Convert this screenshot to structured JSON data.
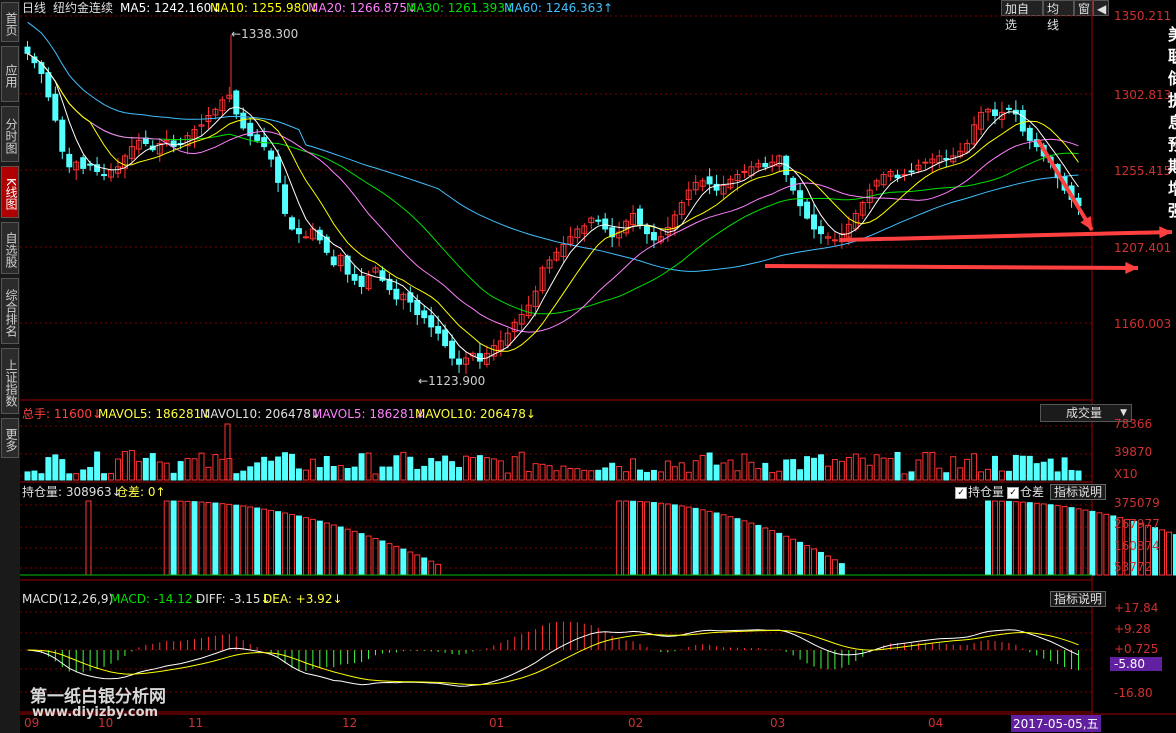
{
  "sidebar": {
    "tabs": [
      {
        "label": "首页"
      },
      {
        "label": "应用"
      },
      {
        "label": "分时图"
      },
      {
        "label": "K线图"
      },
      {
        "label": "自选股"
      },
      {
        "label": "综合排名"
      },
      {
        "label": "上证指数"
      },
      {
        "label": "更多"
      }
    ]
  },
  "header": {
    "period": "日线",
    "instrument": "纽约金连续",
    "ma5": "MA5: 1242.160↓",
    "ma10": "MA10: 1255.980↓",
    "ma20": "MA20: 1266.875↓",
    "ma30": "MA30: 1261.393↓",
    "ma60": "MA60: 1246.363↑",
    "buttons": [
      "加自选",
      "均线",
      "窗"
    ]
  },
  "colors": {
    "up": "#ff3232",
    "down": "#54ffff",
    "ma5": "#ffffff",
    "ma10": "#ffff00",
    "ma20": "#ff80ff",
    "ma30": "#00e000",
    "ma60": "#40c0ff",
    "grid": "#800000",
    "arrow": "#ff4040"
  },
  "price_axis": [
    "1350.211",
    "1302.813",
    "1255.415",
    "1207.401",
    "1160.003"
  ],
  "annotations": {
    "high": "1338.300",
    "low": "1123.900"
  },
  "right_edge_chars": [
    "美",
    "联",
    "储",
    "提",
    "息",
    "预",
    "期",
    "增",
    "强"
  ],
  "volume_panel": {
    "label": "总手: 11600↓",
    "mavol5a": "MAVOL5: 186281↓",
    "mavol10a": "MAVOL10: 206478↓",
    "mavol5b": "MAVOL5: 186281↓",
    "mavol10b": "MAVOL10: 206478↓",
    "selector": "成交量",
    "axis": [
      "78366",
      "39870",
      "X10"
    ]
  },
  "oi_panel": {
    "label": "持仓量: 308963↓",
    "diff": "仓差: 0↑",
    "check_oi": "持仓量",
    "check_diff": "仓差",
    "help": "指标说明",
    "axis": [
      "375079",
      "267977",
      "160874",
      "53772"
    ]
  },
  "macd_panel": {
    "label": "MACD(12,26,9)",
    "macd": "MACD: -14.12↓",
    "diff": "DIFF: -3.15↓",
    "dea": "DEA: +3.92↓",
    "help": "指标说明",
    "axis": [
      "+17.84",
      "+9.28",
      "+0.725",
      "-5.80",
      "-16.80"
    ]
  },
  "x_axis": [
    "09",
    "10",
    "11",
    "12",
    "01",
    "02",
    "03",
    "04"
  ],
  "cursor_date": "2017-05-05,五",
  "watermark": {
    "line1": "第一纸白银分析网",
    "line2": "www.diyizby.com"
  },
  "chart_data": {
    "type": "candlestick",
    "title": "纽约金连续 日线",
    "ylim": [
      1105,
      1352
    ],
    "closes": [
      1328,
      1322,
      1315,
      1300,
      1285,
      1265,
      1255,
      1258,
      1254,
      1256,
      1252,
      1250,
      1253,
      1255,
      1262,
      1268,
      1272,
      1270,
      1266,
      1270,
      1272,
      1268,
      1270,
      1275,
      1279,
      1282,
      1288,
      1292,
      1298,
      1301,
      1289,
      1280,
      1275,
      1272,
      1268,
      1260,
      1245,
      1225,
      1215,
      1212,
      1210,
      1215,
      1208,
      1200,
      1192,
      1198,
      1186,
      1182,
      1178,
      1185,
      1190,
      1182,
      1176,
      1170,
      1173,
      1168,
      1160,
      1158,
      1152,
      1148,
      1140,
      1132,
      1128,
      1132,
      1135,
      1130,
      1135,
      1140,
      1143,
      1148,
      1155,
      1160,
      1166,
      1175,
      1190,
      1195,
      1200,
      1205,
      1210,
      1215,
      1217,
      1222,
      1220,
      1215,
      1210,
      1213,
      1220,
      1225,
      1218,
      1212,
      1208,
      1210,
      1216,
      1224,
      1232,
      1240,
      1245,
      1246,
      1244,
      1240,
      1243,
      1247,
      1250,
      1252,
      1255,
      1257,
      1255,
      1258,
      1262,
      1250,
      1240,
      1230,
      1222,
      1215,
      1212,
      1210,
      1208,
      1212,
      1218,
      1225,
      1232,
      1240,
      1246,
      1250,
      1252,
      1248,
      1250,
      1252,
      1256,
      1258,
      1260,
      1262,
      1260,
      1262,
      1265,
      1270,
      1282,
      1290,
      1292,
      1288,
      1290,
      1292,
      1289,
      1278,
      1272,
      1268,
      1262,
      1258,
      1248,
      1240,
      1234,
      1230
    ]
  }
}
